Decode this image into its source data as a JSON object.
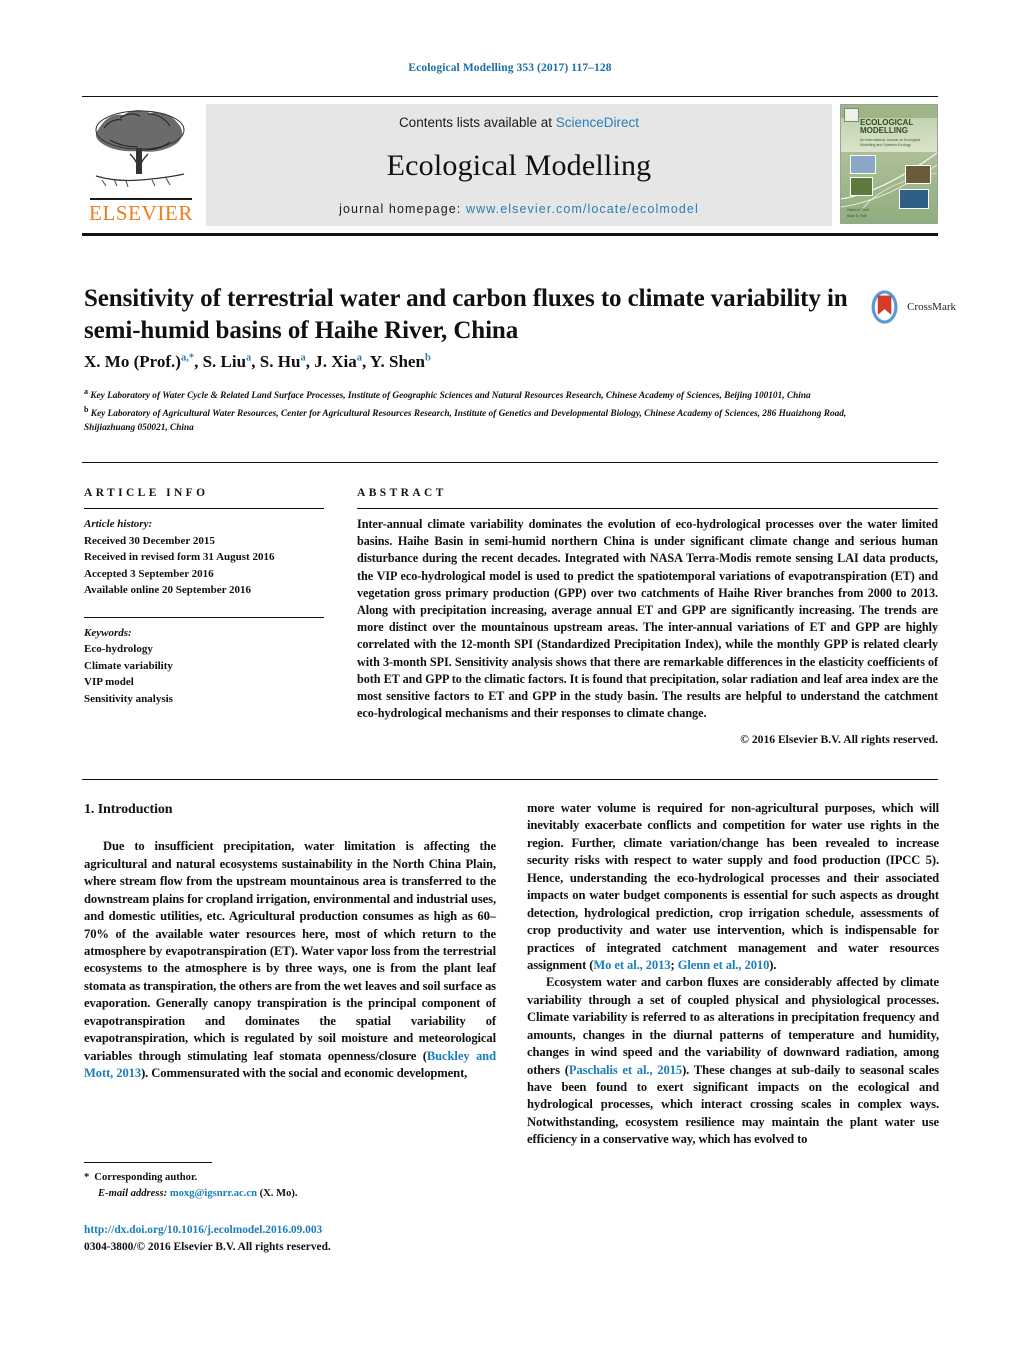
{
  "running_head": "Ecological Modelling 353 (2017) 117–128",
  "masthead": {
    "contents_prefix": "Contents lists available at ",
    "sciencedirect": "ScienceDirect",
    "journal_title": "Ecological Modelling",
    "homepage_prefix": "journal homepage: ",
    "homepage_url": "www.elsevier.com/locate/ecolmodel",
    "publisher": "ELSEVIER",
    "cover": {
      "title_line1": "ECOLOGICAL",
      "title_line2": "MODELLING",
      "subtitle": "An International Journal on Ecological Modelling and Systems Ecology",
      "footer": "Editor-in-Chief\nBrian D. Fath"
    },
    "accent_link_color": "#2a7db5",
    "elsevier_orange": "#ef7d1a"
  },
  "article": {
    "title": "Sensitivity of terrestrial water and carbon fluxes to climate variability in semi-humid basins of Haihe River, China",
    "crossmark_label": "CrossMark",
    "authors_html": "X. Mo (Prof.)<sup>a,*</sup>, S. Liu<sup>a</sup>, S. Hu<sup>a</sup>, J. Xia<sup>a</sup>, Y. Shen<sup>b</sup>",
    "affiliations": [
      "a Key Laboratory of Water Cycle & Related Land Surface Processes, Institute of Geographic Sciences and Natural Resources Research, Chinese Academy of Sciences, Beijing 100101, China",
      "b Key Laboratory of Agricultural Water Resources, Center for Agricultural Resources Research, Institute of Genetics and Developmental Biology, Chinese Academy of Sciences, 286 Huaizhong Road, Shijiazhuang 050021, China"
    ]
  },
  "article_info": {
    "heading": "ARTICLE INFO",
    "history_label": "Article history:",
    "history": [
      "Received 30 December 2015",
      "Received in revised form 31 August 2016",
      "Accepted 3 September 2016",
      "Available online 20 September 2016"
    ],
    "keywords_label": "Keywords:",
    "keywords": [
      "Eco-hydrology",
      "Climate variability",
      "VIP model",
      "Sensitivity analysis"
    ]
  },
  "abstract": {
    "heading": "ABSTRACT",
    "text": "Inter-annual climate variability dominates the evolution of eco-hydrological processes over the water limited basins. Haihe Basin in semi-humid northern China is under significant climate change and serious human disturbance during the recent decades. Integrated with NASA Terra-Modis remote sensing LAI data products, the VIP eco-hydrological model is used to predict the spatiotemporal variations of evapotranspiration (ET) and vegetation gross primary production (GPP) over two catchments of Haihe River branches from 2000 to 2013. Along with precipitation increasing, average annual ET and GPP are significantly increasing. The trends are more distinct over the mountainous upstream areas. The inter-annual variations of ET and GPP are highly correlated with the 12-month SPI (Standardized Precipitation Index), while the monthly GPP is related clearly with 3-month SPI. Sensitivity analysis shows that there are remarkable differences in the elasticity coefficients of both ET and GPP to the climatic factors. It is found that precipitation, solar radiation and leaf area index are the most sensitive factors to ET and GPP in the study basin. The results are helpful to understand the catchment eco-hydrological mechanisms and their responses to climate change.",
    "copyright": "© 2016 Elsevier B.V. All rights reserved."
  },
  "body": {
    "section_heading": "1. Introduction",
    "left_p1": "Due to insufficient precipitation, water limitation is affecting the agricultural and natural ecosystems sustainability in the North China Plain, where stream flow from the upstream mountainous area is transferred to the downstream plains for cropland irrigation, environmental and industrial uses, and domestic utilities, etc. Agricultural production consumes as high as 60–70% of the available water resources here, most of which return to the atmosphere by evapotranspiration (ET). Water vapor loss from the terrestrial ecosystems to the atmosphere is by three ways, one is from the plant leaf stomata as transpiration, the others are from the wet leaves and soil surface as evaporation. Generally canopy transpiration is the principal component of evapotranspiration and dominates the spatial variability of evapotranspiration, which is regulated by soil moisture and meteorological variables through stimulating leaf stomata openness/closure (",
    "left_p1_ref": "Buckley and Mott, 2013",
    "left_p1_tail": "). Commensurated with the social and economic development,",
    "right_p1": "more water volume is required for non-agricultural purposes, which will inevitably exacerbate conflicts and competition for water use rights in the region. Further, climate variation/change has been revealed to increase security risks with respect to water supply and food production (IPCC 5). Hence, understanding the eco-hydrological processes and their associated impacts on water budget components is essential for such aspects as drought detection, hydrological prediction, crop irrigation schedule, assessments of crop productivity and water use intervention, which is indispensable for practices of integrated catchment management and water resources assignment (",
    "right_p1_ref_a": "Mo et al., 2013",
    "right_p1_sep": "; ",
    "right_p1_ref_b": "Glenn et al., 2010",
    "right_p1_tail": ").",
    "right_p2": "Ecosystem water and carbon fluxes are considerably affected by climate variability through a set of coupled physical and physiological processes. Climate variability is referred to as alterations in precipitation frequency and amounts, changes in the diurnal patterns of temperature and humidity, changes in wind speed and the variability of downward radiation, among others (",
    "right_p2_ref": "Paschalis et al., 2015",
    "right_p2_tail": "). These changes at sub-daily to seasonal scales have been found to exert significant impacts on the ecological and hydrological processes, which interact crossing scales in complex ways. Notwithstanding, ecosystem resilience may maintain the plant water use efficiency in a conservative way, which has evolved to"
  },
  "footer": {
    "corresponding_marker": "*",
    "corresponding_label": "Corresponding author.",
    "email_label": "E-mail address:",
    "email": "moxg@igsnrr.ac.cn",
    "email_suffix": "(X. Mo).",
    "doi": "http://dx.doi.org/10.1016/j.ecolmodel.2016.09.003",
    "issn_line": "0304-3800/© 2016 Elsevier B.V. All rights reserved."
  }
}
